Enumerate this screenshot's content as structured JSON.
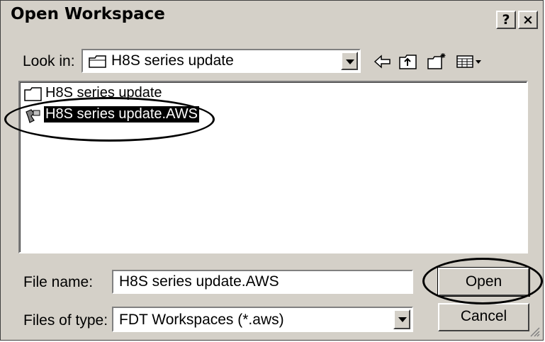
{
  "window": {
    "title": "Open Workspace",
    "help_label": "?",
    "close_label": "×"
  },
  "lookin": {
    "label": "Look in:",
    "value": "H8S series update"
  },
  "toolbar": {
    "icons": [
      "back-icon",
      "up-folder-icon",
      "new-folder-icon",
      "view-menu-icon"
    ]
  },
  "files": [
    {
      "name": "H8S series update",
      "type": "folder",
      "selected": false
    },
    {
      "name": "H8S series update.AWS",
      "type": "workspace",
      "selected": true
    }
  ],
  "filename": {
    "label": "File name:",
    "value": "H8S series update.AWS"
  },
  "filetype": {
    "label": "Files of type:",
    "value": "FDT Workspaces (*.aws)"
  },
  "buttons": {
    "open": "Open",
    "cancel": "Cancel"
  }
}
